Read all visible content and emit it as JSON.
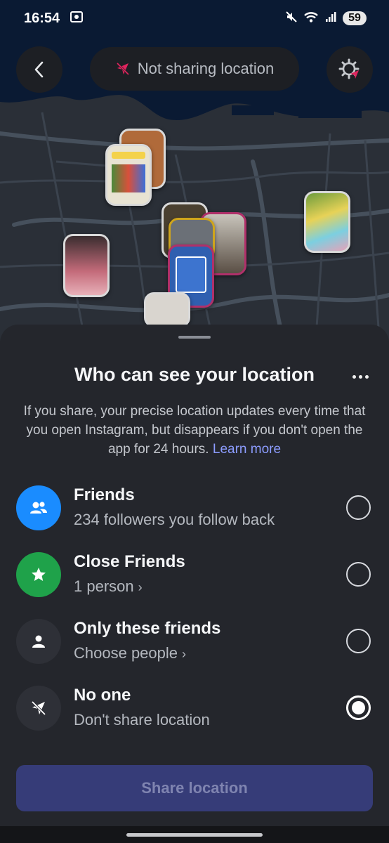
{
  "status_bar": {
    "time": "16:54",
    "battery": "59",
    "icons": [
      "screenshot-icon",
      "mute-icon",
      "wifi-icon",
      "signal-icon"
    ]
  },
  "top_bar": {
    "back_icon": "chevron-left-icon",
    "status_text": "Not sharing location",
    "status_icon": "location-off-icon",
    "settings_icon": "location-settings-icon"
  },
  "sheet": {
    "title": "Who can see your location",
    "more_icon": "more-horizontal-icon",
    "description": "If you share, your precise location updates every time that you open Instagram, but disappears if you don't open the app for 24 hours.",
    "learn_more": "Learn more",
    "options": [
      {
        "title": "Friends",
        "subtitle": "234 followers you follow back",
        "icon": "friends-icon",
        "color": "#1a8cff",
        "selected": false
      },
      {
        "title": "Close Friends",
        "subtitle": "1 person",
        "icon": "star-icon",
        "color": "#1fa24a",
        "selected": false
      },
      {
        "title": "Only these friends",
        "subtitle": "Choose people",
        "icon": "person-icon",
        "color": "#2e3037",
        "selected": false
      },
      {
        "title": "No one",
        "subtitle": "Don't share location",
        "icon": "location-off-icon",
        "color": "#2e3037",
        "selected": true
      }
    ],
    "chevron": "›",
    "share_button": "Share location"
  },
  "colors": {
    "accent_link": "#8c9cff",
    "share_button_bg": "#363c78",
    "sheet_bg": "#24262c"
  }
}
